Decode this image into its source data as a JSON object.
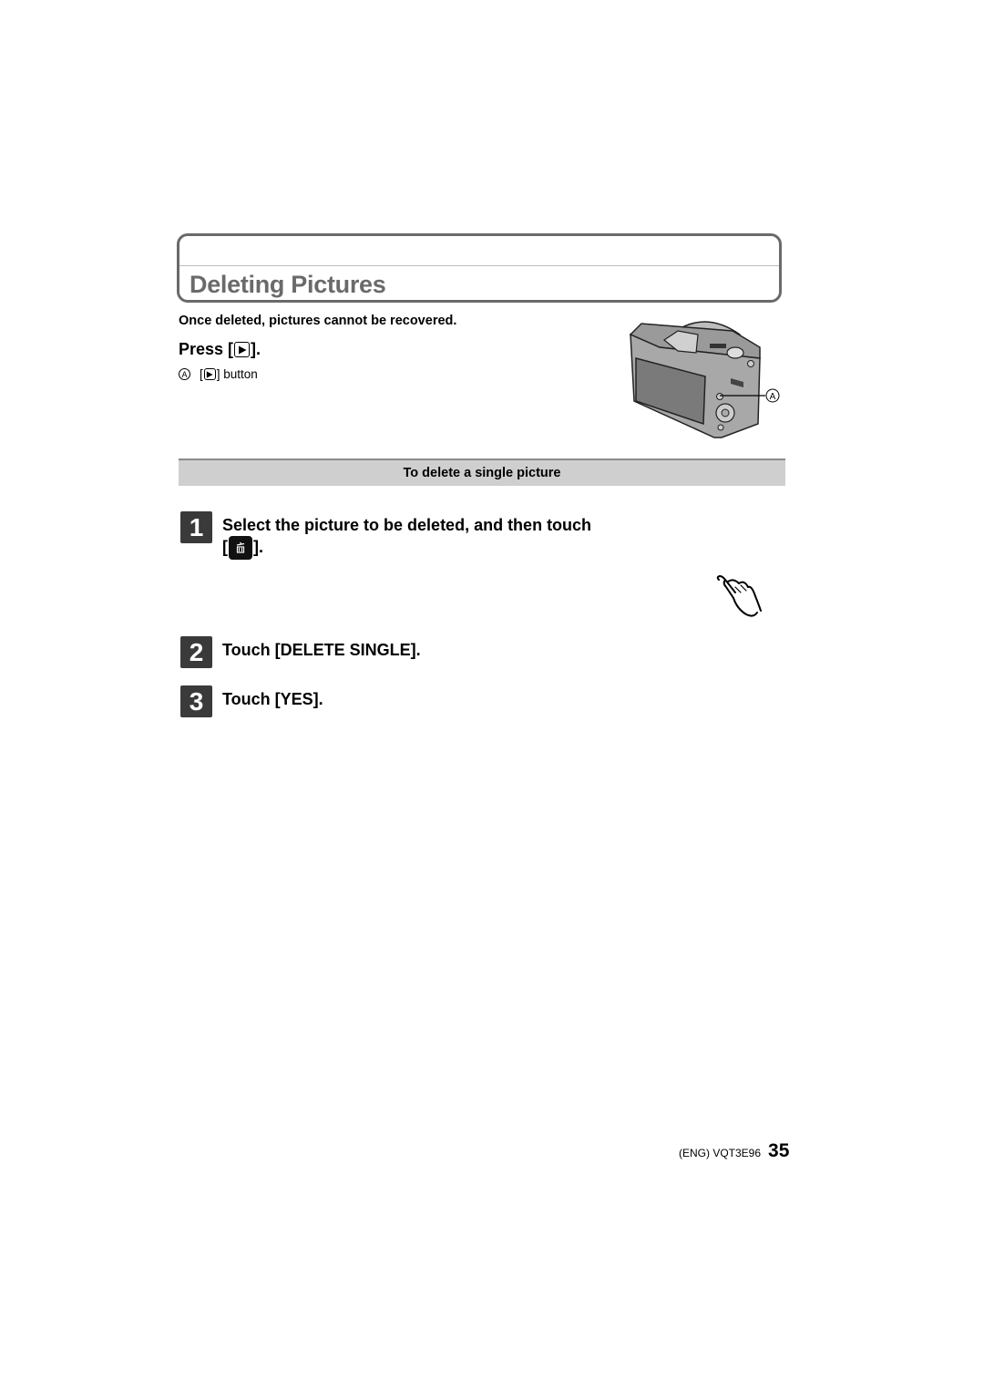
{
  "header": {
    "title": "Deleting Pictures"
  },
  "intro": {
    "warning": "Once deleted, pictures cannot be recovered.",
    "press_prefix": "Press [",
    "press_suffix": "].",
    "press_icon": "playback-icon",
    "callout_letter": "A",
    "callout_prefix": "[",
    "callout_suffix": "] button"
  },
  "figure": {
    "description": "camera-rear-illustration",
    "callout_letter": "A"
  },
  "section": {
    "title": "To delete a single picture"
  },
  "steps": [
    {
      "number": "1",
      "text_before": "Select the picture to be deleted, and then touch",
      "text_after_open": "[",
      "text_after_close": "].",
      "icon": "trash-icon"
    },
    {
      "number": "2",
      "text": "Touch [DELETE SINGLE]."
    },
    {
      "number": "3",
      "text": "Touch [YES]."
    }
  ],
  "touch_icon": "touch-hand-icon",
  "footer": {
    "code": "(ENG) VQT3E96",
    "page": "35"
  }
}
